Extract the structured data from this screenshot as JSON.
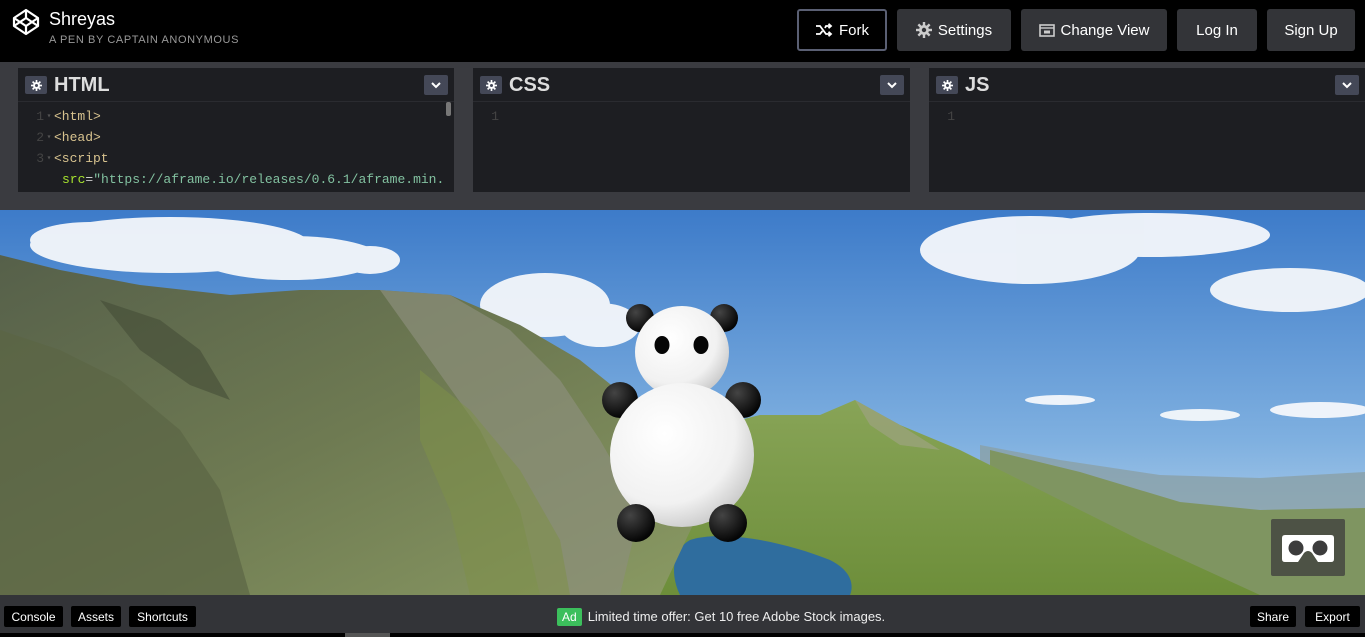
{
  "header": {
    "title": "Shreyas",
    "author": "A PEN BY CAPTAIN ANONYMOUS",
    "buttons": {
      "fork": "Fork",
      "settings": "Settings",
      "change_view": "Change View",
      "log_in": "Log In",
      "sign_up": "Sign Up"
    }
  },
  "editors": [
    {
      "name": "HTML",
      "lines": [
        {
          "num": "1",
          "text": "<html>"
        },
        {
          "num": "2",
          "text": "<head>"
        },
        {
          "num": "3",
          "text": "<script"
        },
        {
          "num": "",
          "attr": "src",
          "value": "\"https://aframe.io/releases/0.6.1/aframe.min."
        }
      ]
    },
    {
      "name": "CSS",
      "lines": [
        {
          "num": "1"
        }
      ]
    },
    {
      "name": "JS",
      "lines": [
        {
          "num": "1"
        }
      ]
    }
  ],
  "footer": {
    "console": "Console",
    "assets": "Assets",
    "shortcuts": "Shortcuts",
    "ad_badge": "Ad",
    "ad_text": "Limited time offer: Get 10 free Adobe Stock images.",
    "share": "Share",
    "export": "Export"
  },
  "colors": {
    "header_bg": "#000000",
    "button_bg": "#333438",
    "editor_bg": "#1d1e22",
    "ad_green": "#3cbf5c"
  },
  "icons": [
    "codepen-logo-icon",
    "fork-icon",
    "gear-icon",
    "change-view-icon",
    "chevron-down-icon",
    "vr-headset-icon"
  ]
}
